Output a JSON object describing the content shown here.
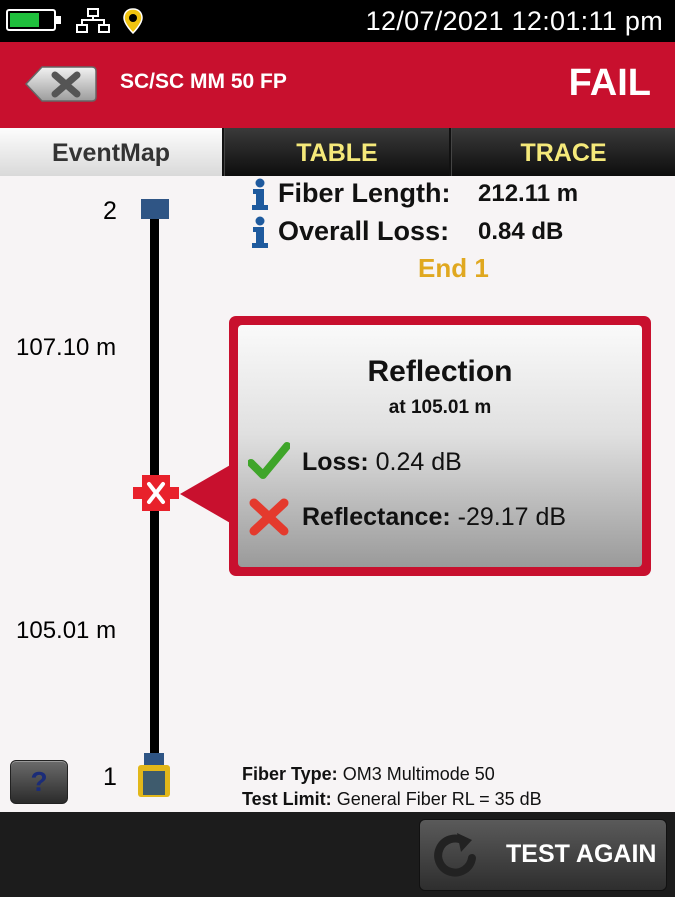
{
  "status_bar": {
    "datetime": "12/07/2021  12:01:11 pm",
    "battery_level": 0.7,
    "icons": [
      "battery-icon",
      "network-icon",
      "location-pin-icon"
    ]
  },
  "header": {
    "title": "SC/SC MM 50 FP",
    "result": "FAIL",
    "colors": {
      "bar": "#c8102e",
      "text": "#ffffff"
    }
  },
  "tabs": [
    {
      "label": "EventMap",
      "active": true
    },
    {
      "label": "TABLE",
      "active": false
    },
    {
      "label": "TRACE",
      "active": false
    }
  ],
  "summary": {
    "fiber_length_label": "Fiber Length:",
    "fiber_length_value": "212.11 m",
    "overall_loss_label": "Overall Loss:",
    "overall_loss_value": "0.84 dB",
    "end_label": "End 1"
  },
  "event_map": {
    "end_top_number": "2",
    "end_bottom_number": "1",
    "distance_upper": "107.10 m",
    "distance_lower": "105.01 m"
  },
  "event_popup": {
    "title": "Reflection",
    "position": "at 105.01 m",
    "loss_label": "Loss:",
    "loss_value": "0.24 dB",
    "loss_status": "pass",
    "reflectance_label": "Reflectance:",
    "reflectance_value": "-29.17 dB",
    "reflectance_status": "fail"
  },
  "fiber_info": {
    "fiber_type_label": "Fiber Type:",
    "fiber_type_value": "OM3 Multimode 50",
    "test_limit_label": "Test Limit:",
    "test_limit_value": "General Fiber RL = 35 dB"
  },
  "buttons": {
    "help_label": "?",
    "test_again_label": "TEST AGAIN"
  }
}
